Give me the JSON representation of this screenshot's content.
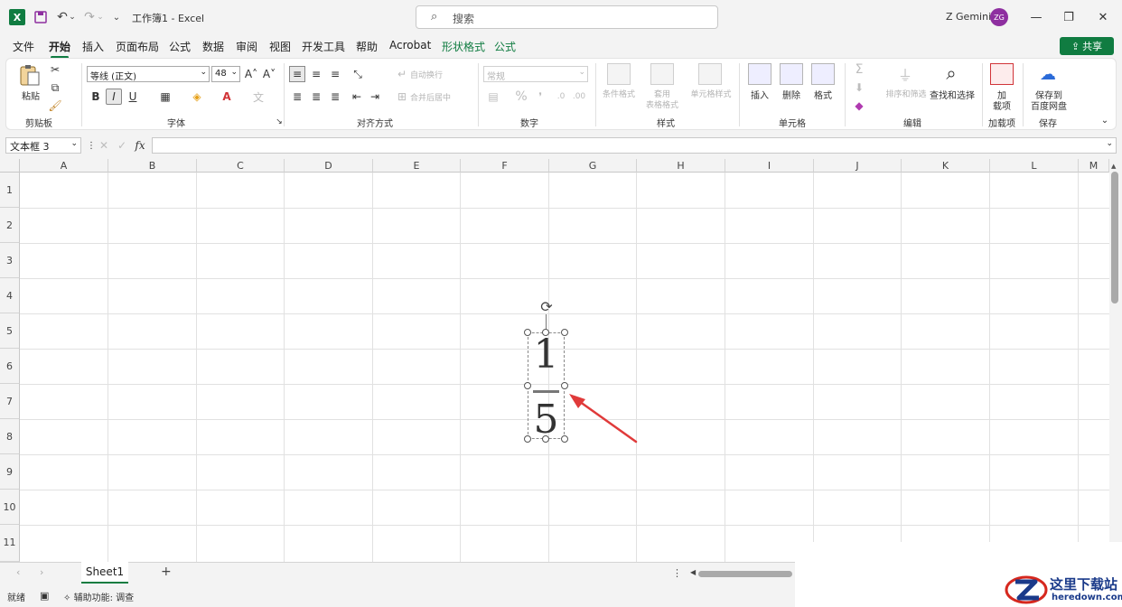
{
  "titlebar": {
    "logo_letter": "X",
    "title": "工作簿1 - Excel",
    "search_placeholder": "搜索",
    "user_name": "Z Gemini",
    "avatar_initials": "ZG"
  },
  "menu": {
    "tabs": [
      "文件",
      "开始",
      "插入",
      "页面布局",
      "公式",
      "数据",
      "审阅",
      "视图",
      "开发工具",
      "帮助",
      "Acrobat",
      "形状格式",
      "公式"
    ],
    "active_tab": "开始",
    "share_label": "共享"
  },
  "ribbon": {
    "clipboard": {
      "paste": "粘贴",
      "label": "剪贴板"
    },
    "font": {
      "name": "等线 (正文)",
      "size": "48",
      "bold": "B",
      "italic": "I",
      "underline": "U",
      "label": "字体"
    },
    "alignment": {
      "wrap": "自动换行",
      "merge": "合并后居中",
      "label": "对齐方式"
    },
    "number": {
      "format": "常规",
      "label": "数字"
    },
    "styles": {
      "conditional": "条件格式",
      "table_a": "套用",
      "table_b": "表格格式",
      "cell_styles": "单元格样式",
      "label": "样式"
    },
    "cells": {
      "insert": "插入",
      "delete": "删除",
      "format": "格式",
      "label": "单元格"
    },
    "editing": {
      "sort": "排序和筛选",
      "find": "查找和选择",
      "label": "编辑"
    },
    "addins": {
      "line1": "加",
      "line2": "载项",
      "label": "加载项"
    },
    "save": {
      "line1": "保存到",
      "line2": "百度网盘",
      "label": "保存"
    }
  },
  "formula_bar": {
    "name_box": "文本框 3",
    "fx": "fx",
    "content": ""
  },
  "grid": {
    "columns": [
      "A",
      "B",
      "C",
      "D",
      "E",
      "F",
      "G",
      "H",
      "I",
      "J",
      "K",
      "L",
      "M"
    ],
    "rows": [
      "1",
      "2",
      "3",
      "4",
      "5",
      "6",
      "7",
      "8",
      "9",
      "10",
      "11"
    ]
  },
  "textbox": {
    "numerator": "1",
    "denominator": "5",
    "arrow_color": "#e03a3a"
  },
  "sheets": {
    "tabs": [
      "Sheet1"
    ],
    "add": "+"
  },
  "status": {
    "ready": "就绪",
    "accessibility": "辅助功能: 调查"
  },
  "watermark": {
    "cn": "这里下载站",
    "en": "heredown.com"
  },
  "colors": {
    "accent": "#107c41",
    "avatar": "#8e2fa0",
    "arrow": "#e03a3a"
  }
}
